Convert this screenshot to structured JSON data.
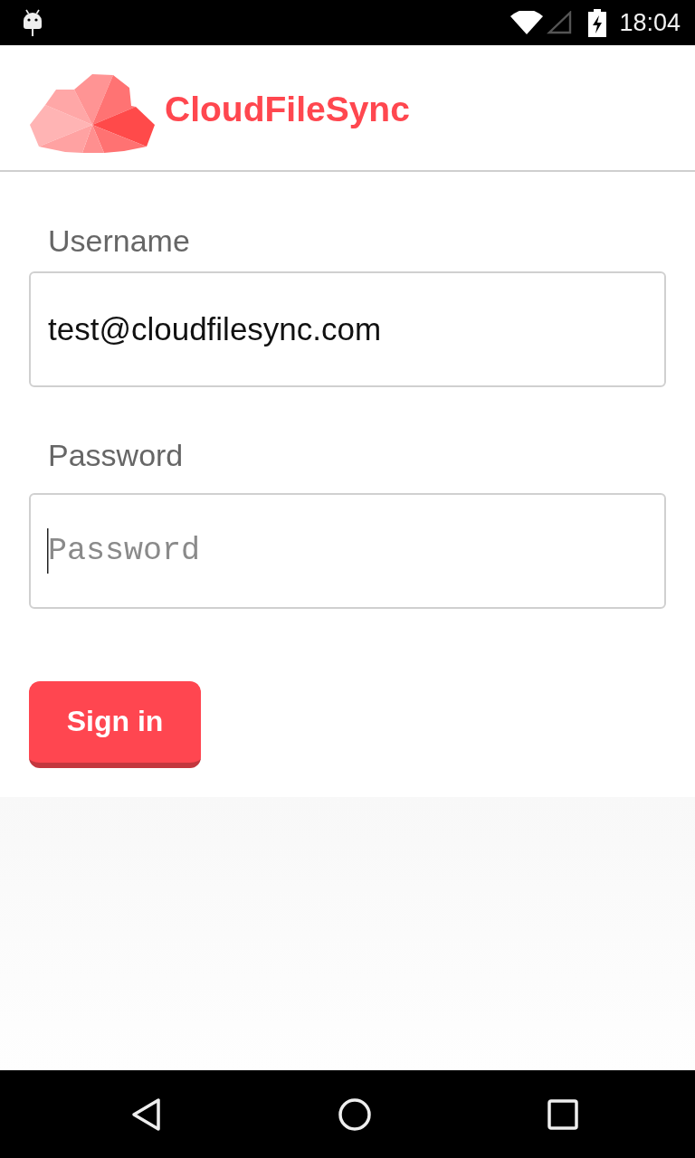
{
  "status_bar": {
    "time": "18:04"
  },
  "header": {
    "app_name": "CloudFileSync"
  },
  "form": {
    "fields": [
      {
        "kind": "text",
        "label": "Username",
        "value": "test@cloudfilesync.com",
        "focused": false
      },
      {
        "kind": "password",
        "label": "Password",
        "placeholder": "Password",
        "focused": true
      }
    ]
  },
  "sign_in_button": {
    "label": "Sign in"
  }
}
